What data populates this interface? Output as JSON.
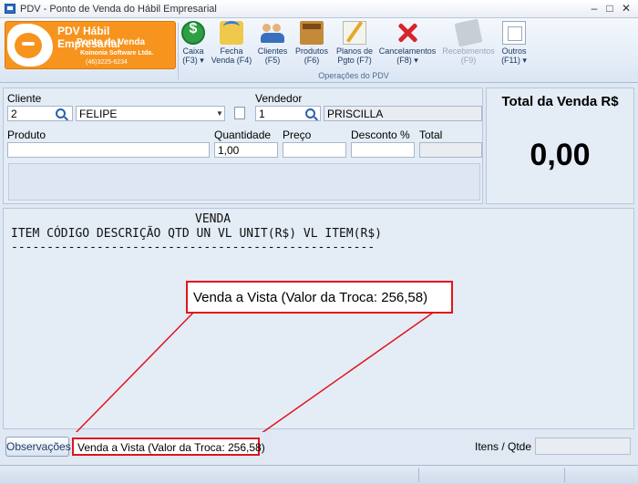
{
  "window": {
    "title": "PDV - Ponto de Venda do Hábil Empresarial",
    "minimize": "–",
    "maximize": "□",
    "close": "✕"
  },
  "brand": {
    "title": "PDV Hábil Empresarial",
    "subtitle": "Ponto de Venda",
    "company": "Koinonia Software Ltda.",
    "phone": "(46)3225-6234"
  },
  "ribbon": {
    "group_label": "Operações do PDV",
    "buttons": [
      {
        "label1": "Caixa",
        "label2": "(F3) ▾",
        "icon": "cash-icon",
        "enabled": true
      },
      {
        "label1": "Fecha",
        "label2": "Venda (F4)",
        "icon": "close-sale-icon",
        "enabled": true
      },
      {
        "label1": "Clientes",
        "label2": "(F5)",
        "icon": "clients-icon",
        "enabled": true
      },
      {
        "label1": "Produtos",
        "label2": "(F6)",
        "icon": "products-icon",
        "enabled": true
      },
      {
        "label1": "Planos de",
        "label2": "Pgto (F7)",
        "icon": "payment-plans-icon",
        "enabled": true
      },
      {
        "label1": "Cancelamentos",
        "label2": "(F8) ▾",
        "icon": "cancel-icon",
        "enabled": true
      },
      {
        "label1": "Recebimentos",
        "label2": "(F9)",
        "icon": "receipts-icon",
        "enabled": false
      },
      {
        "label1": "Outros",
        "label2": "(F11) ▾",
        "icon": "others-icon",
        "enabled": true
      }
    ]
  },
  "form": {
    "cliente_label": "Cliente",
    "cliente_code": "2",
    "cliente_name": "FELIPE",
    "vendedor_label": "Vendedor",
    "vendedor_code": "1",
    "vendedor_name": "PRISCILLA",
    "produto_label": "Produto",
    "produto_value": "",
    "quantidade_label": "Quantidade",
    "quantidade_value": "1,00",
    "preco_label": "Preço",
    "preco_value": "",
    "desconto_label": "Desconto %",
    "desconto_value": "",
    "total_label": "Total",
    "total_value": ""
  },
  "total_panel": {
    "title": "Total da Venda R$",
    "value": "0,00"
  },
  "receipt": {
    "header": "VENDA",
    "columns": "ITEM CÓDIGO DESCRIÇÃO QTD UN VL UNIT(R$) VL ITEM(R$)",
    "separator": "---------------------------------------------------"
  },
  "callout": {
    "text": "Venda a Vista (Valor da Troca: 256,58)"
  },
  "bottom": {
    "observacoes_label": "Observações",
    "observacoes_text": "Venda a Vista (Valor da Troca: 256,58)",
    "itens_label": "Itens / Qtde",
    "itens_value": ""
  },
  "colors": {
    "highlight": "#e0141a",
    "brand": "#f7941d"
  }
}
